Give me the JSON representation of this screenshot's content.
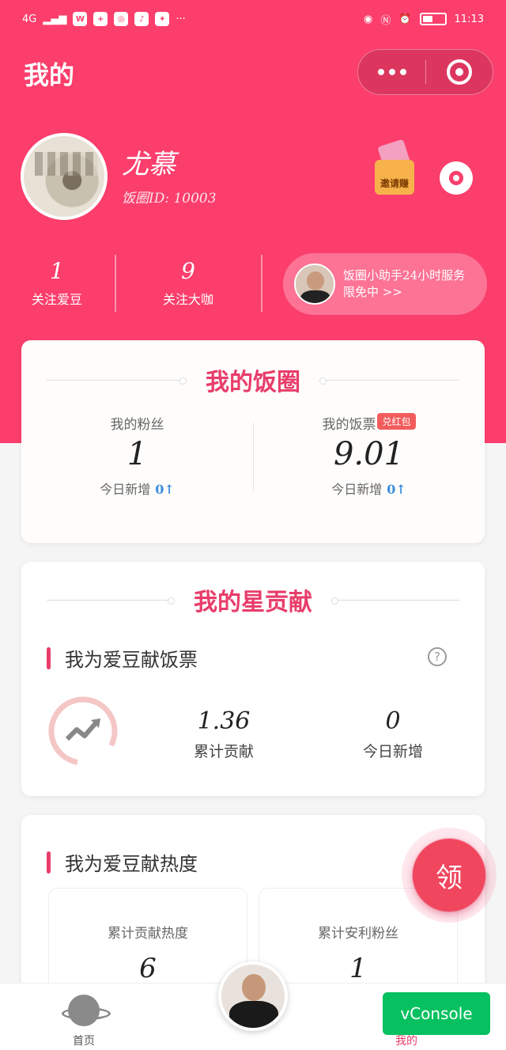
{
  "status_bar": {
    "network": "4G",
    "time": "11:13",
    "app_icons": [
      "W",
      "+",
      "◎",
      "♪",
      "✦"
    ],
    "more": "···"
  },
  "header": {
    "title": "我的"
  },
  "colors": {
    "brand": "#fb3e6c",
    "accent": "#e83d6a",
    "vconsole": "#07c160"
  },
  "profile": {
    "name": "尤慕",
    "id_text": "饭圈ID: 10003",
    "invite_label": "邀请赚"
  },
  "stats": [
    {
      "value": "1",
      "label": "关注爱豆"
    },
    {
      "value": "9",
      "label": "关注大咖"
    }
  ],
  "assistant": {
    "line1": "饭圈小助手24小时服务",
    "line2": "限免中 >>"
  },
  "fanquan": {
    "title": "我的饭圈",
    "fans": {
      "label": "我的粉丝",
      "value": "1",
      "today": "今日新增",
      "today_value": "0↑"
    },
    "tickets": {
      "label": "我的饭票",
      "badge": "兑红包",
      "value": "9.01",
      "today": "今日新增",
      "today_value": "0↑"
    }
  },
  "star": {
    "title": "我的星贡献",
    "section": "我为爱豆献饭票",
    "help": "?",
    "total": {
      "value": "1.36",
      "label": "累计贡献"
    },
    "today": {
      "value": "0",
      "label": "今日新增"
    }
  },
  "heat": {
    "section": "我为爱豆献热度",
    "boxes": [
      {
        "label": "累计贡献热度",
        "value": "6"
      },
      {
        "label": "累计安利粉丝",
        "value": "1"
      }
    ]
  },
  "claim_button": "领",
  "tabbar": {
    "home": "首页",
    "mine": "我的"
  },
  "vconsole": "vConsole"
}
